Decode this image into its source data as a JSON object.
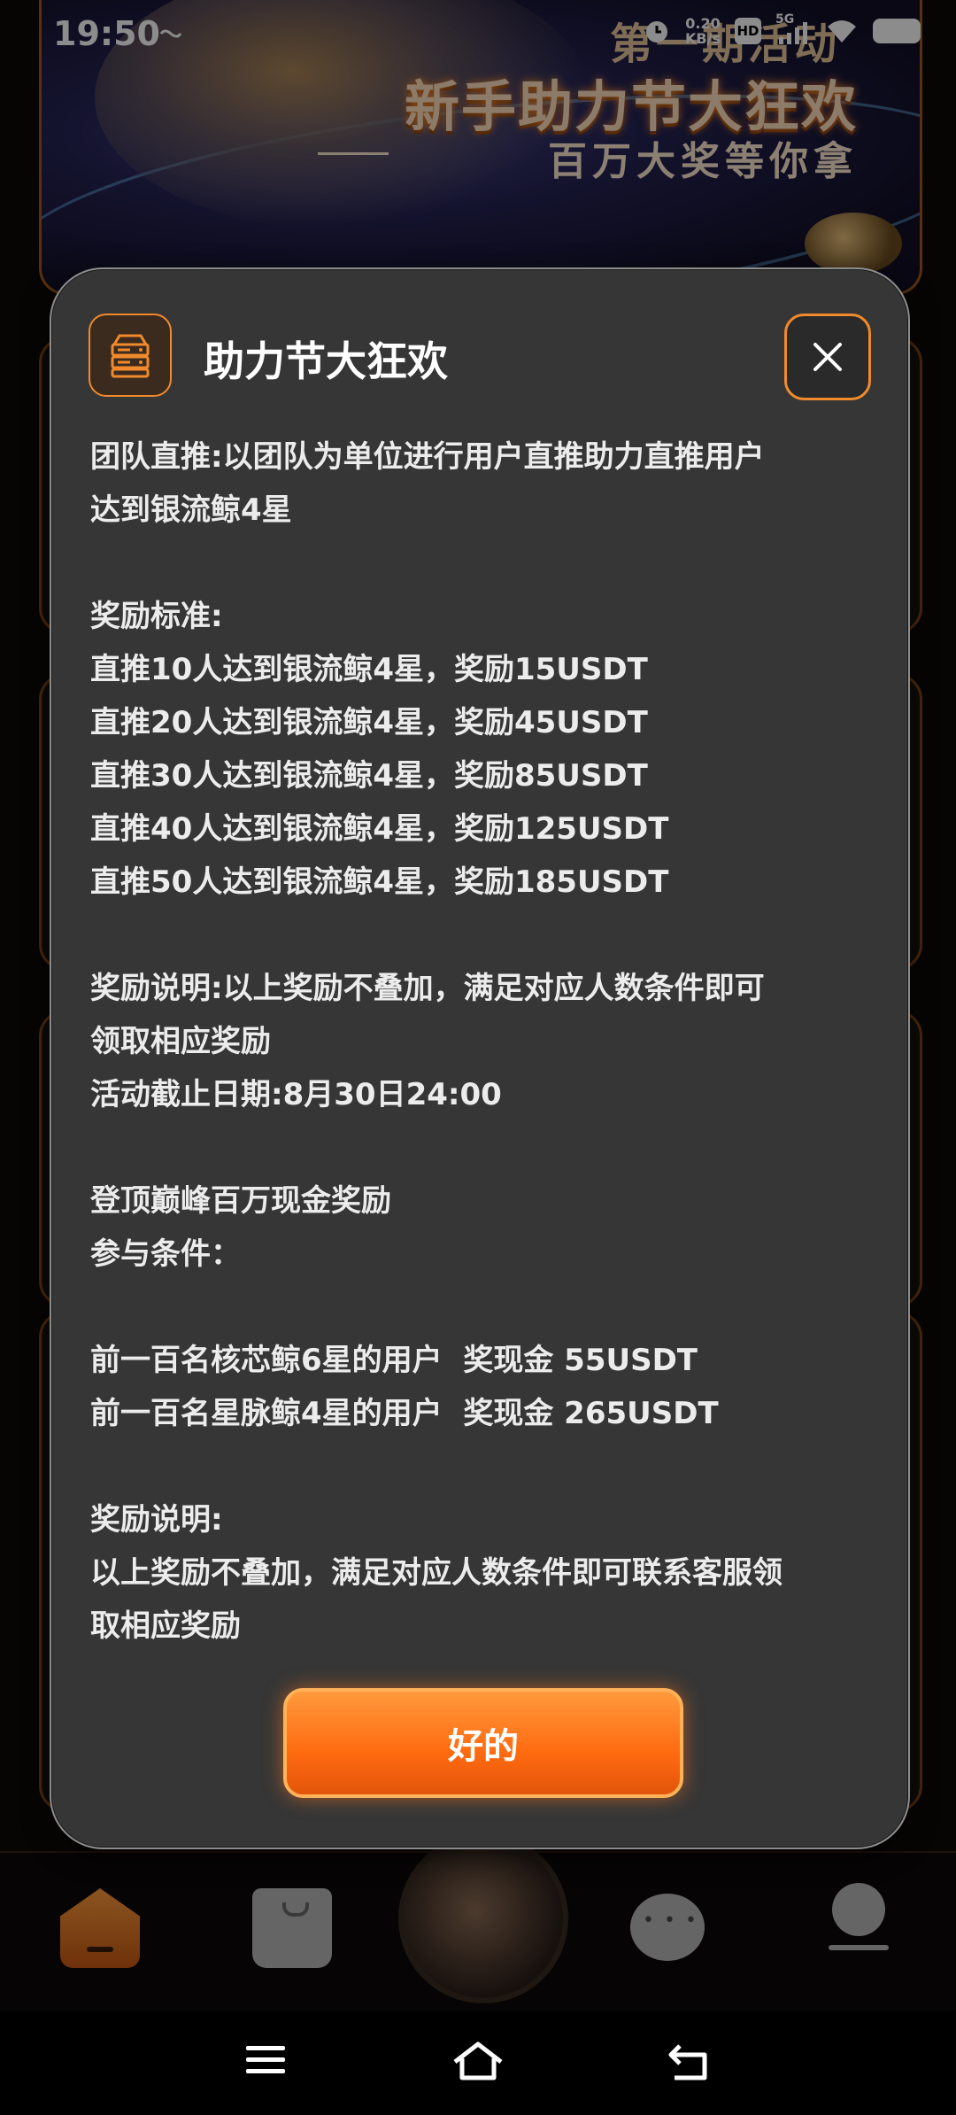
{
  "status_bar": {
    "time": "19:50",
    "net_speed_value": "0.20",
    "net_speed_unit": "KB/s",
    "hd_label": "HD",
    "signal_label": "5G"
  },
  "banner": {
    "kicker": "第一期活动",
    "title": "新手助力节大狂欢",
    "subtitle": "百万大奖等你拿"
  },
  "dialog": {
    "title": "助力节大狂欢",
    "lines": [
      "团队直推:以团队为单位进行用户直推助力直推用户",
      "达到银流鲸4星",
      "",
      "奖励标准:",
      "直推10人达到银流鲸4星，奖励15USDT",
      "直推20人达到银流鲸4星，奖励45USDT",
      "直推30人达到银流鲸4星，奖励85USDT",
      "直推40人达到银流鲸4星，奖励125USDT",
      "直推50人达到银流鲸4星，奖励185USDT",
      "",
      "奖励说明:以上奖励不叠加，满足对应人数条件即可",
      "领取相应奖励",
      "活动截止日期:8月30日24:00",
      "",
      "登顶巅峰百万现金奖励",
      "参与条件：",
      "",
      "前一百名核芯鲸6星的用户  奖现金 55USDT",
      "前一百名星脉鲸4星的用户  奖现金 265USDT",
      "",
      "奖励说明:",
      "以上奖励不叠加，满足对应人数条件即可联系客服领",
      "取相应奖励"
    ],
    "ok_label": "好的"
  },
  "icons": {
    "dialog_icon": "server-stack-icon",
    "close": "close-icon",
    "bottom_nav": [
      "home-icon",
      "shopping-bag-icon",
      "whale-center-icon",
      "chat-icon",
      "profile-icon"
    ],
    "system_nav": [
      "menu-icon",
      "home-outline-icon",
      "back-icon"
    ]
  },
  "colors": {
    "accent": "#f08a2c",
    "dialog_bg": "#363636",
    "button_gradient_top": "#ff9a3c",
    "button_gradient_bottom": "#e2550a"
  }
}
